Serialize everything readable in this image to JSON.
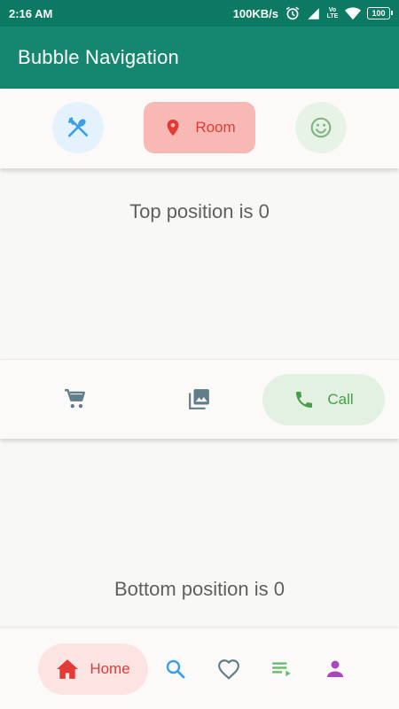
{
  "status_bar": {
    "time": "2:16 AM",
    "network_speed": "100KB/s",
    "network_type": "Vo LTE",
    "battery": "100",
    "icons": [
      "alarm-icon",
      "signal-icon",
      "wifi-icon",
      "battery-icon"
    ]
  },
  "app_bar": {
    "title": "Bubble Navigation",
    "color": "#14876e"
  },
  "top_nav": {
    "selected": "room",
    "items": [
      {
        "id": "restaurant",
        "icon": "fork-spoon-icon",
        "label": "",
        "color": "#3b9ee6",
        "bg": "#e3f2fc"
      },
      {
        "id": "room",
        "icon": "location-pin-icon",
        "label": "Room",
        "color": "#e53935",
        "bg": "#f8b9b4"
      },
      {
        "id": "happy",
        "icon": "smiley-icon",
        "label": "",
        "color": "#7cb87f",
        "bg": "#e8f3e8"
      }
    ]
  },
  "top_section": {
    "text": "Top position is 0"
  },
  "mid_nav": {
    "selected": "call",
    "items": [
      {
        "id": "cart",
        "icon": "shopping-cart-icon",
        "label": "",
        "color": "#607d8b"
      },
      {
        "id": "photos",
        "icon": "photo-library-icon",
        "label": "",
        "color": "#607d8b"
      },
      {
        "id": "call",
        "icon": "phone-icon",
        "label": "Call",
        "color": "#43a047",
        "bg": "#e3f1e3"
      }
    ]
  },
  "bottom_section": {
    "text": "Bottom position is 0"
  },
  "bottom_nav": {
    "selected": "home",
    "items": [
      {
        "id": "home",
        "icon": "home-icon",
        "label": "Home",
        "color": "#e53935",
        "bg": "#fbe4e2"
      },
      {
        "id": "search",
        "icon": "search-icon",
        "label": "",
        "color": "#3b9ee6"
      },
      {
        "id": "favorites",
        "icon": "heart-icon",
        "label": "",
        "color": "#607d8b"
      },
      {
        "id": "playlist",
        "icon": "playlist-icon",
        "label": "",
        "color": "#66bb6a"
      },
      {
        "id": "profile",
        "icon": "person-icon",
        "label": "",
        "color": "#ab47bc"
      }
    ]
  }
}
